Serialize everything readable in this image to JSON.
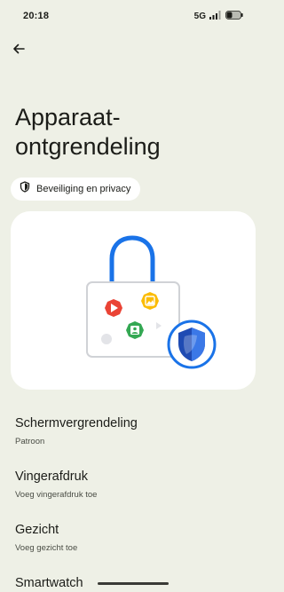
{
  "status_bar": {
    "time": "20:18",
    "network": "5G",
    "icons": [
      "signal-icon",
      "battery-icon"
    ]
  },
  "header": {
    "back_icon": "arrow-left-icon",
    "title": "Apparaat-ontgrendeling"
  },
  "chip": {
    "icon": "shield-icon",
    "label": "Beveiliging en privacy"
  },
  "illustration": {
    "icons": [
      "lock-icon",
      "play-icon",
      "photo-icon",
      "contact-icon",
      "shield-icon"
    ],
    "colors": {
      "shackle": "#1a73e8",
      "play": "#ea4335",
      "photo": "#fbbc04",
      "contact": "#34a853",
      "shield": "#1a73e8"
    }
  },
  "settings": {
    "items": [
      {
        "title": "Schermvergrendeling",
        "subtitle": "Patroon"
      },
      {
        "title": "Vingerafdruk",
        "subtitle": "Voeg vingerafdruk toe"
      },
      {
        "title": "Gezicht",
        "subtitle": "Voeg gezicht toe"
      },
      {
        "title": "Smartwatch",
        "subtitle": ""
      }
    ]
  }
}
